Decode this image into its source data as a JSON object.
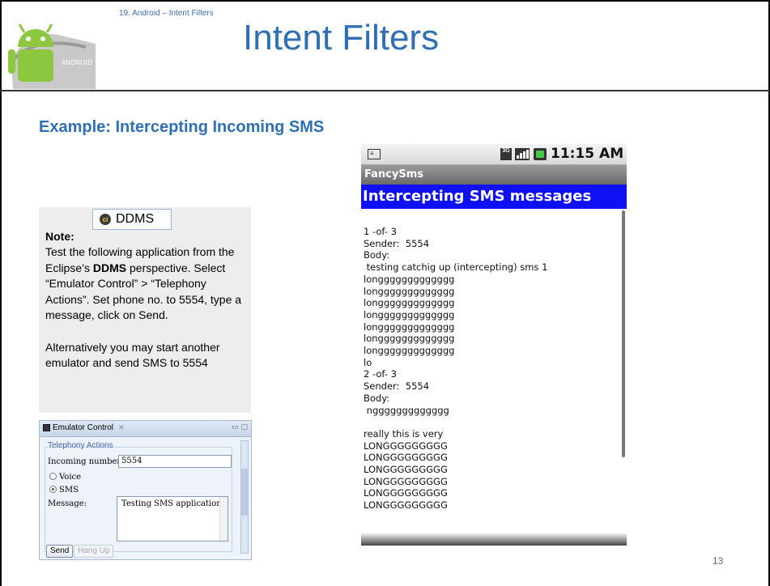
{
  "header": {
    "breadcrumb": "19. Android – Intent Filters",
    "title": "Intent Filters"
  },
  "subtitle": "Example: Intercepting Incoming SMS",
  "note": {
    "title": "Note:",
    "badge_label": "DDMS",
    "line1_pre": "Test the following application from the Eclipse’s ",
    "line1_bold": "DDMS",
    "line1_post": " perspective. Select “Emulator Control” >  “Telephony Actions”. Set phone no. to 5554, type a message, click on Send.",
    "para2": "Alternatively you may start another emulator and send SMS to 5554"
  },
  "emulator_control": {
    "tab_title": "Emulator Control",
    "section": "Telephony Actions",
    "incoming_label": "Incoming number:",
    "incoming_value": "5554",
    "voice_label": "Voice",
    "sms_label": "SMS",
    "message_label": "Message:",
    "message_value": "Testing SMS application",
    "send_label": "Send",
    "hangup_label": "Hang Up"
  },
  "phone": {
    "time": "11:15 AM",
    "app_name": "FancySms",
    "header": "Intercepting SMS messages",
    "content": "1 -of- 3\nSender:  5554\nBody:\n testing catchig up (intercepting) sms 1\nlonggggggggggggg\nlonggggggggggggg\nlonggggggggggggg\nlonggggggggggggg\nlonggggggggggggg\nlonggggggggggggg\nlonggggggggggggg\nlo\n2 -of- 3\nSender:  5554\nBody:\n nggggggggggggg\n\nreally this is very\nLONGGGGGGGGG\nLONGGGGGGGGG\nLONGGGGGGGGG\nLONGGGGGGGGG\nLONGGGGGGGGG\nLONGGGGGGGGG"
  },
  "page_number": "13",
  "colors": {
    "title_blue": "#2f6fb4",
    "phone_header_blue": "#1010f5"
  }
}
